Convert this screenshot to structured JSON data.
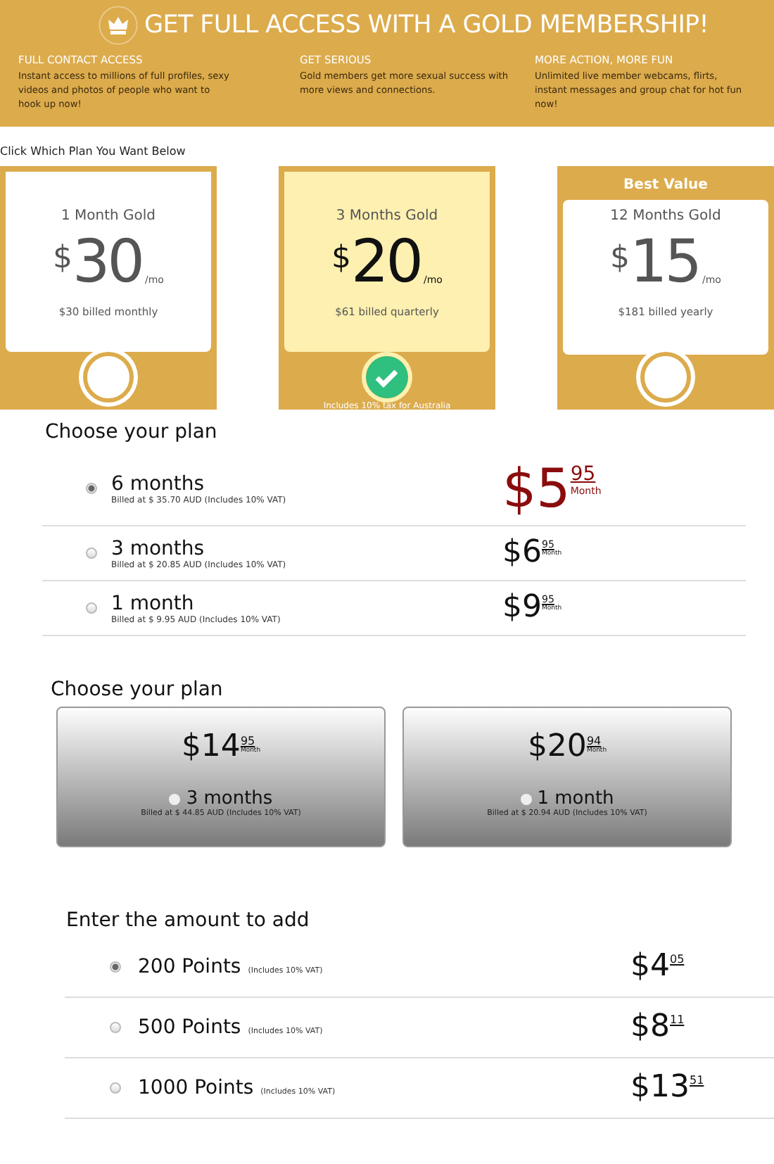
{
  "header": {
    "title": "GET FULL ACCESS WITH A GOLD MEMBERSHIP!",
    "features": [
      {
        "title": "FULL CONTACT ACCESS",
        "text": "Instant access to millions of full profiles, sexy videos and photos of people who want to hook up now!"
      },
      {
        "title": "GET SERIOUS",
        "text": "Gold members get more sexual success with more views and connections."
      },
      {
        "title": "MORE ACTION, MORE FUN",
        "text": "Unlimited live member webcams, flirts, instant messages and group chat for hot fun now!"
      }
    ]
  },
  "plan_prompt": "Click Which Plan You Want Below",
  "gold_plans": [
    {
      "name": "1 Month Gold",
      "currency": "$",
      "amount": "30",
      "unit": "/mo",
      "billing": "$30 billed monthly",
      "selected": false
    },
    {
      "name": "3 Months Gold",
      "currency": "$",
      "amount": "20",
      "unit": "/mo",
      "billing": "$61 billed quarterly",
      "selected": true,
      "note": "Includes 10% tax for Australia"
    },
    {
      "name": "12 Months Gold",
      "currency": "$",
      "amount": "15",
      "unit": "/mo",
      "billing": "$181 billed yearly",
      "selected": false,
      "badge": "Best Value"
    }
  ],
  "plan_list": {
    "heading": "Choose your plan",
    "options": [
      {
        "label": "6 months",
        "billing": "Billed at $ 35.70 AUD (Includes 10% VAT)",
        "price": "$5",
        "cents": "95",
        "per": "Month",
        "selected": true
      },
      {
        "label": "3 months",
        "billing": "Billed at $ 20.85 AUD (Includes 10% VAT)",
        "price": "$6",
        "cents": "95",
        "per": "Month",
        "selected": false
      },
      {
        "label": "1 month",
        "billing": "Billed at $ 9.95 AUD (Includes 10% VAT)",
        "price": "$9",
        "cents": "95",
        "per": "Month",
        "selected": false
      }
    ]
  },
  "plan_tiles": {
    "heading": "Choose your plan",
    "options": [
      {
        "price": "$14",
        "cents": "95",
        "per": "Month",
        "label": "3 months",
        "billing": "Billed at $ 44.85 AUD (Includes 10% VAT)",
        "selected": false
      },
      {
        "price": "$20",
        "cents": "94",
        "per": "Month",
        "label": "1 month",
        "billing": "Billed at $ 20.94 AUD (Includes 10% VAT)",
        "selected": false
      }
    ]
  },
  "points": {
    "heading": "Enter the amount to add",
    "options": [
      {
        "label": "200 Points",
        "note": "(Includes 10% VAT)",
        "price": "$4",
        "cents": "05",
        "selected": true
      },
      {
        "label": "500 Points",
        "note": "(Includes 10% VAT)",
        "price": "$8",
        "cents": "11",
        "selected": false
      },
      {
        "label": "1000 Points",
        "note": "(Includes 10% VAT)",
        "price": "$13",
        "cents": "51",
        "selected": false
      }
    ]
  }
}
